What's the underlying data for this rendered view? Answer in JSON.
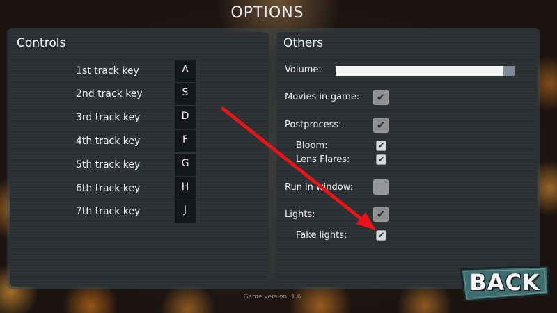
{
  "screen_title": "OPTIONS",
  "controls": {
    "heading": "Controls",
    "rows": [
      {
        "label": "1st track key",
        "key": "A"
      },
      {
        "label": "2nd track key",
        "key": "S"
      },
      {
        "label": "3rd track key",
        "key": "D"
      },
      {
        "label": "4th track key",
        "key": "F"
      },
      {
        "label": "5th track key",
        "key": "G"
      },
      {
        "label": "6th track key",
        "key": "H"
      },
      {
        "label": "7th track key",
        "key": "J"
      }
    ]
  },
  "others": {
    "heading": "Others",
    "volume": {
      "label": "Volume:",
      "level": 0.93
    },
    "movies": {
      "label": "Movies in-game:",
      "checked": true
    },
    "postprocess": {
      "label": "Postprocess:",
      "checked": true
    },
    "bloom": {
      "label": "Bloom:",
      "checked": true
    },
    "lens_flares": {
      "label": "Lens Flares:",
      "checked": true
    },
    "run_in_window": {
      "label": "Run in window:",
      "checked": false
    },
    "lights": {
      "label": "Lights:",
      "checked": true
    },
    "fake_lights": {
      "label": "Fake lights:",
      "checked": true
    }
  },
  "footer": {
    "version": "Game version: 1.6"
  },
  "back_button": {
    "label": "BACK",
    "color": "#3f6e70"
  },
  "check_glyph": "✔",
  "annotation": {
    "arrow_color": "#e8141a"
  }
}
